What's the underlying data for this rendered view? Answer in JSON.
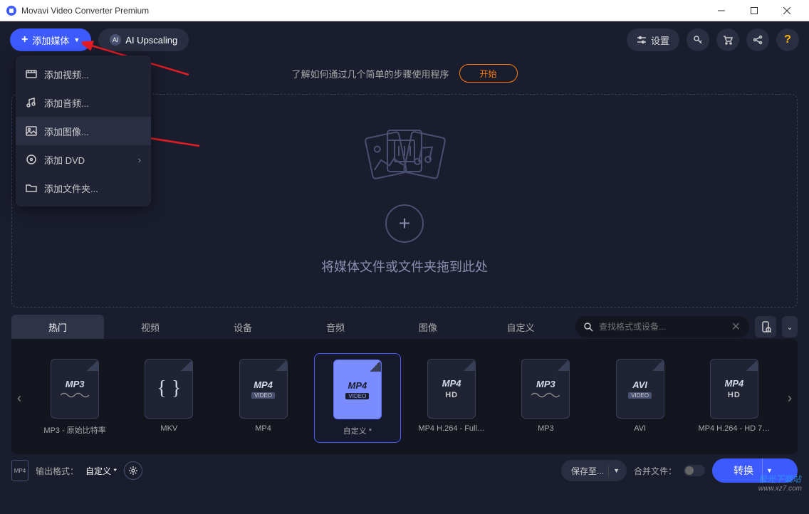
{
  "window": {
    "title": "Movavi Video Converter Premium"
  },
  "toolbar": {
    "add_media": "添加媒体",
    "ai_upscaling": "AI Upscaling",
    "settings": "设置"
  },
  "dropdown": {
    "items": [
      {
        "label": "添加视频...",
        "icon": "video"
      },
      {
        "label": "添加音频...",
        "icon": "audio"
      },
      {
        "label": "添加图像...",
        "icon": "image"
      },
      {
        "label": "添加 DVD",
        "icon": "dvd",
        "chevron": true
      },
      {
        "label": "添加文件夹...",
        "icon": "folder"
      }
    ]
  },
  "info": {
    "text": "了解如何通过几个简单的步骤使用程序",
    "start": "开始"
  },
  "drop": {
    "text": "将媒体文件或文件夹拖到此处"
  },
  "tabs": {
    "items": [
      "热门",
      "视频",
      "设备",
      "音频",
      "图像",
      "自定义"
    ],
    "active": 0,
    "search_placeholder": "查找格式或设备..."
  },
  "formats": [
    {
      "fmt": "MP3",
      "sub": "",
      "label": "MP3 - 原始比特率",
      "kind": "mp3"
    },
    {
      "fmt": "MKV",
      "sub": "",
      "label": "MKV",
      "kind": "curly"
    },
    {
      "fmt": "MP4",
      "sub": "VIDEO",
      "label": "MP4",
      "kind": "mp4"
    },
    {
      "fmt": "MP4",
      "sub": "VIDEO",
      "label": "自定义 *",
      "kind": "mp4",
      "selected": true
    },
    {
      "fmt": "MP4",
      "sub": "HD",
      "label": "MP4 H.264 - Full…",
      "kind": "mp4hd"
    },
    {
      "fmt": "MP3",
      "sub": "",
      "label": "MP3",
      "kind": "mp3"
    },
    {
      "fmt": "AVI",
      "sub": "VIDEO",
      "label": "AVI",
      "kind": "avi"
    },
    {
      "fmt": "MP4",
      "sub": "HD",
      "label": "MP4 H.264 - HD 7…",
      "kind": "mp4hd"
    }
  ],
  "bottom": {
    "output_label": "输出格式：",
    "output_value": "自定义 *",
    "save_to": "保存至...",
    "merge": "合并文件：",
    "convert": "转换"
  },
  "watermark": {
    "line1": "极光下载站",
    "line2": "www.xz7.com"
  }
}
